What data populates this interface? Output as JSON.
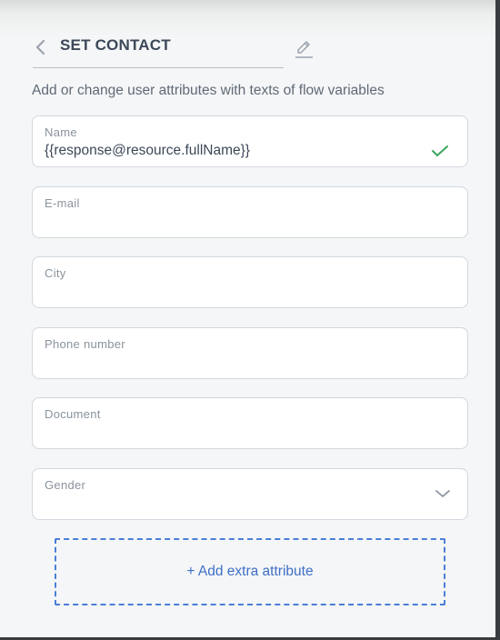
{
  "header": {
    "back_icon": "chevron-left-icon",
    "title": "SET CONTACT",
    "edit_icon": "pencil-icon"
  },
  "description": "Add or change user attributes with texts of flow variables",
  "fields": [
    {
      "label": "Name",
      "value": "{{response@resource.fullName}}",
      "icon": "check-icon",
      "icon_color": "#3aa55d"
    },
    {
      "label": "E-mail",
      "value": ""
    },
    {
      "label": "City",
      "value": ""
    },
    {
      "label": "Phone number",
      "value": ""
    },
    {
      "label": "Document",
      "value": ""
    },
    {
      "label": "Gender",
      "value": "",
      "icon": "chevron-down-icon"
    }
  ],
  "add_button": {
    "label": "+ Add extra attribute"
  },
  "colors": {
    "accent": "#4a7fd6",
    "title": "#3c4858",
    "success": "#3aa55d"
  }
}
